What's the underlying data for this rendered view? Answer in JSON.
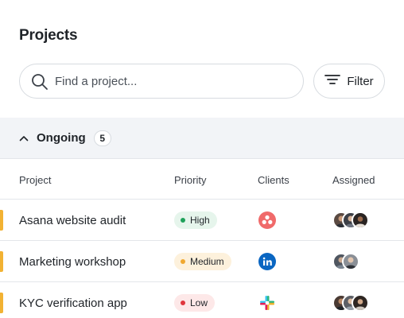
{
  "page": {
    "title": "Projects"
  },
  "search": {
    "placeholder": "Find a project..."
  },
  "filter": {
    "label": "Filter"
  },
  "group": {
    "label": "Ongoing",
    "count": "5"
  },
  "columns": {
    "project": "Project",
    "priority": "Priority",
    "clients": "Clients",
    "assigned": "Assigned"
  },
  "colors": {
    "row_accent": "#f2b233",
    "high": "#1fa15a",
    "medium": "#f0a830",
    "low": "#e0363d"
  },
  "rows": [
    {
      "name": "Asana website audit",
      "priority": "High",
      "client_icon": "asana-logo-icon",
      "assignees": 3
    },
    {
      "name": "Marketing workshop",
      "priority": "Medium",
      "client_icon": "linkedin-logo-icon",
      "assignees": 2
    },
    {
      "name": "KYC verification app",
      "priority": "Low",
      "client_icon": "slack-logo-icon",
      "assignees": 3
    }
  ]
}
